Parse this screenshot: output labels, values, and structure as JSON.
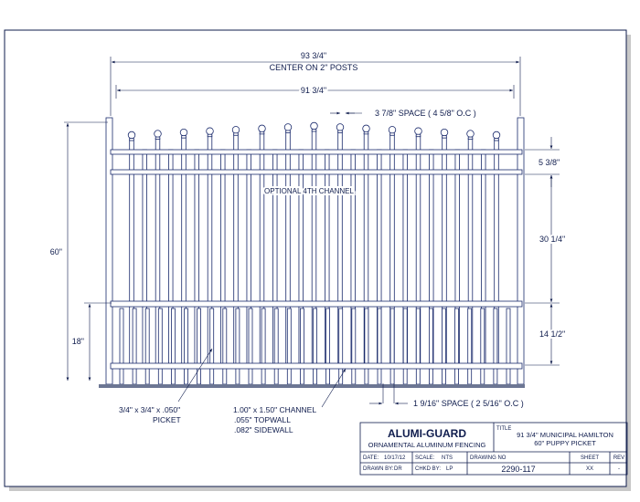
{
  "dimensions": {
    "overall_width": "93 3/4\"",
    "overall_width_note": "CENTER ON 2\" POSTS",
    "panel_width": "91 3/4\"",
    "picket_space": "3 7/8\" SPACE ( 4 5/8\" O.C )",
    "total_height": "60\"",
    "top_rail_gap": "5 3/8\"",
    "mid_height": "30 1/4\"",
    "bottom_height": "14 1/2\"",
    "puppy_height": "18\"",
    "puppy_space": "1 9/16\" SPACE ( 2 5/16\" O.C )"
  },
  "notes": {
    "optional_channel": "OPTIONAL 4TH CHANNEL",
    "picket_size": "3/4\" x 3/4\" x .050\"",
    "picket_label": "PICKET",
    "channel_size": "1.00\" x 1.50\" CHANNEL",
    "topwall": ".055\" TOPWALL",
    "sidewall": ".082\" SIDEWALL"
  },
  "title_block": {
    "brand": "ALUMI-GUARD",
    "subtitle": "ORNAMENTAL ALUMINUM FENCING",
    "title_label": "TITLE",
    "title_line1": "91 3/4\" MUNICIPAL HAMILTON",
    "title_line2": "60\" PUPPY PICKET",
    "date_label": "DATE:",
    "date_value": "10/17/12",
    "scale_label": "SCALE:",
    "scale_value": "NTS",
    "drawing_no_label": "DRAWING NO",
    "drawing_no_value": "2290-117",
    "drawn_label": "DRAWN BY:",
    "drawn_value": "DR",
    "chkd_label": "CHKD BY:",
    "chkd_value": "LP",
    "sheet_label": "SHEET",
    "sheet_value": "XX",
    "rev_label": "REV",
    "rev_value": "-"
  },
  "colors": {
    "line": "#1a2a6c",
    "text": "#0f1c4d",
    "ground": "#6c7693"
  }
}
